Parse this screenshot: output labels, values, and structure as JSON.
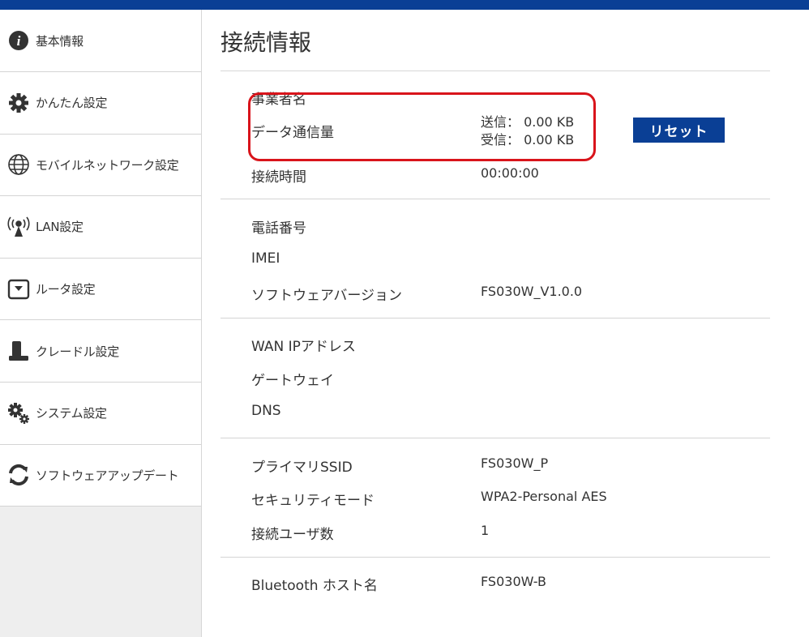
{
  "sidebar": {
    "items": [
      {
        "label": "基本情報",
        "icon": "info-icon"
      },
      {
        "label": "かんたん設定",
        "icon": "gear-icon"
      },
      {
        "label": "モバイルネットワーク設定",
        "icon": "globe-icon"
      },
      {
        "label": "LAN設定",
        "icon": "antenna-icon"
      },
      {
        "label": "ルータ設定",
        "icon": "router-icon"
      },
      {
        "label": "クレードル設定",
        "icon": "cradle-icon"
      },
      {
        "label": "システム設定",
        "icon": "gears-icon"
      },
      {
        "label": "ソフトウェアアップデート",
        "icon": "refresh-icon"
      }
    ]
  },
  "main": {
    "title": "接続情報",
    "connection": {
      "provider_label": "事業者名",
      "provider_value": "",
      "traffic_label": "データ通信量",
      "sent": "送信： 0.00 KB",
      "received": "受信： 0.00 KB",
      "reset_label": "リセット",
      "time_label": "接続時間",
      "time_value": "00:00:00"
    },
    "device": {
      "phone_label": "電話番号",
      "phone_value": "",
      "imei_label": "IMEI",
      "imei_value": "",
      "sw_label": "ソフトウェアバージョン",
      "sw_value": "FS030W_V1.0.0"
    },
    "network": {
      "wan_label": "WAN IPアドレス",
      "wan_value": "",
      "gateway_label": "ゲートウェイ",
      "gateway_value": "",
      "dns_label": "DNS",
      "dns_value": ""
    },
    "wifi": {
      "ssid_label": "プライマリSSID",
      "ssid_value": "FS030W_P",
      "security_label": "セキュリティモード",
      "security_value": "WPA2-Personal AES",
      "users_label": "接続ユーザ数",
      "users_value": "1"
    },
    "bluetooth": {
      "host_label": "Bluetooth ホスト名",
      "host_value": "FS030W-B"
    }
  },
  "colors": {
    "brand": "#0a3f95",
    "highlight": "#d9141b",
    "sidebar_bg": "#eeeeee"
  }
}
